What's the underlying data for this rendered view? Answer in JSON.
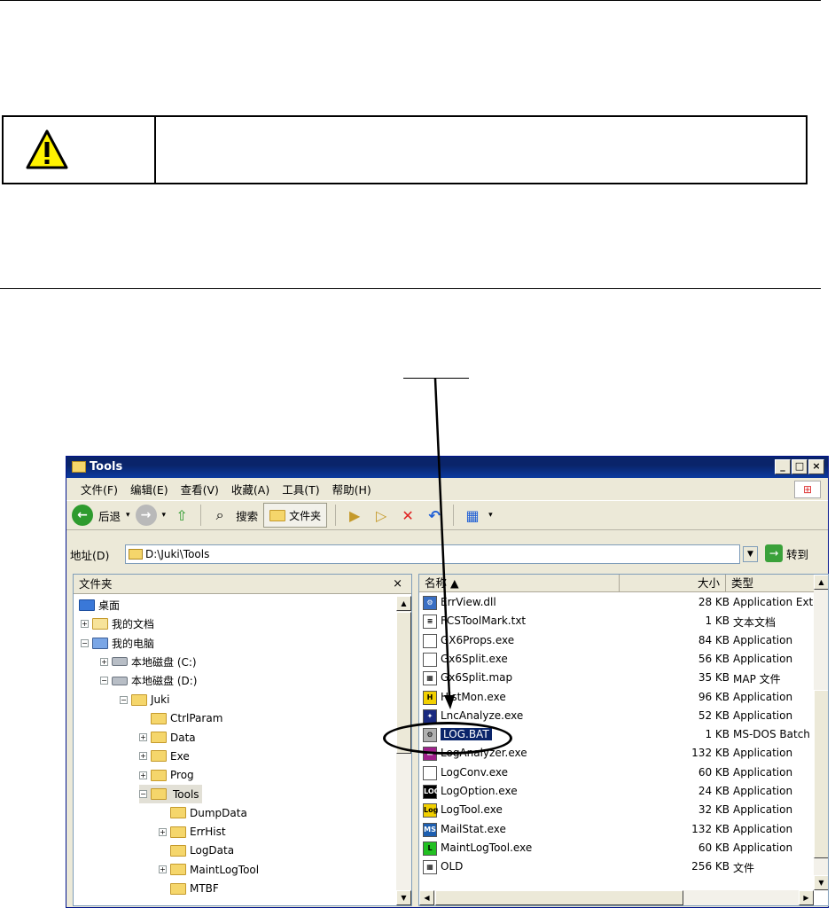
{
  "window": {
    "title": "Tools",
    "buttons": [
      "_",
      "□",
      "×"
    ],
    "menu": [
      "文件(F)",
      "编辑(E)",
      "查看(V)",
      "收藏(A)",
      "工具(T)",
      "帮助(H)"
    ],
    "toolbar": {
      "back": "后退",
      "search": "搜索",
      "folders": "文件夹"
    },
    "address": {
      "label": "地址(D)",
      "path": "D:\\Juki\\Tools",
      "go": "转到"
    }
  },
  "left_pane": {
    "title": "文件夹",
    "close": "×",
    "tree": [
      {
        "label": "桌面",
        "level": 0,
        "expander": "",
        "icon": "desktop-icon"
      },
      {
        "label": "我的文档",
        "level": 1,
        "expander": "+",
        "icon": "documents-icon"
      },
      {
        "label": "我的电脑",
        "level": 1,
        "expander": "−",
        "icon": "computer-icon"
      },
      {
        "label": "本地磁盘 (C:)",
        "level": 2,
        "expander": "+",
        "icon": "drive-icon"
      },
      {
        "label": "本地磁盘 (D:)",
        "level": 2,
        "expander": "−",
        "icon": "drive-icon"
      },
      {
        "label": "Juki",
        "level": 3,
        "expander": "−",
        "icon": "folder-icon"
      },
      {
        "label": "CtrlParam",
        "level": 4,
        "expander": "",
        "icon": "folder-icon"
      },
      {
        "label": "Data",
        "level": 4,
        "expander": "+",
        "icon": "folder-icon"
      },
      {
        "label": "Exe",
        "level": 4,
        "expander": "+",
        "icon": "folder-icon"
      },
      {
        "label": "Prog",
        "level": 4,
        "expander": "+",
        "icon": "folder-icon"
      },
      {
        "label": "Tools",
        "level": 4,
        "expander": "−",
        "icon": "folder-icon",
        "selected": true
      },
      {
        "label": "DumpData",
        "level": 5,
        "expander": "",
        "icon": "folder-icon"
      },
      {
        "label": "ErrHist",
        "level": 5,
        "expander": "+",
        "icon": "folder-icon"
      },
      {
        "label": "LogData",
        "level": 5,
        "expander": "",
        "icon": "folder-icon"
      },
      {
        "label": "MaintLogTool",
        "level": 5,
        "expander": "+",
        "icon": "folder-icon"
      },
      {
        "label": "MTBF",
        "level": 5,
        "expander": "",
        "icon": "folder-icon"
      }
    ]
  },
  "right_pane": {
    "columns": [
      "名称 ▲",
      "大小",
      "类型"
    ],
    "files": [
      {
        "name": "ErrView.dll",
        "size": "28 KB",
        "type": "Application Exte",
        "icon": "dll-icon",
        "badge": "⚙",
        "color": "#3a6fc4"
      },
      {
        "name": "FCSToolMark.txt",
        "size": "1 KB",
        "type": "文本文档",
        "icon": "text-file-icon",
        "badge": "≡",
        "color": "#ffffff"
      },
      {
        "name": "GX6Props.exe",
        "size": "84 KB",
        "type": "Application",
        "icon": "window-app-icon",
        "badge": "",
        "color": "#ffffff"
      },
      {
        "name": "Gx6Split.exe",
        "size": "56 KB",
        "type": "Application",
        "icon": "window-app-icon",
        "badge": "",
        "color": "#ffffff"
      },
      {
        "name": "Gx6Split.map",
        "size": "35 KB",
        "type": "MAP 文件",
        "icon": "map-file-icon",
        "badge": "▦",
        "color": "#ffffff"
      },
      {
        "name": "HistMon.exe",
        "size": "96 KB",
        "type": "Application",
        "icon": "histmon-icon",
        "badge": "H",
        "color": "#f2d000"
      },
      {
        "name": "LncAnalyze.exe",
        "size": "52 KB",
        "type": "Application",
        "icon": "analyze-icon",
        "badge": "✦",
        "color": "#1a2a80"
      },
      {
        "name": "LOG.BAT",
        "size": "1 KB",
        "type": "MS-DOS Batch",
        "icon": "batch-file-icon",
        "badge": "⚙",
        "color": "#b0b0b0",
        "selected": true
      },
      {
        "name": "LogAnalyzer.exe",
        "size": "132 KB",
        "type": "Application",
        "icon": "loganalyzer-icon",
        "badge": "▬",
        "color": "#a0208c"
      },
      {
        "name": "LogConv.exe",
        "size": "60 KB",
        "type": "Application",
        "icon": "window-app-icon",
        "badge": "",
        "color": "#ffffff"
      },
      {
        "name": "LogOption.exe",
        "size": "24 KB",
        "type": "Application",
        "icon": "logoption-icon",
        "badge": "LOG",
        "color": "#000000"
      },
      {
        "name": "LogTool.exe",
        "size": "32 KB",
        "type": "Application",
        "icon": "logtool-icon",
        "badge": "Log",
        "color": "#f2d000"
      },
      {
        "name": "MailStat.exe",
        "size": "132 KB",
        "type": "Application",
        "icon": "mailstat-icon",
        "badge": "MS",
        "color": "#1e5fb0"
      },
      {
        "name": "MaintLogTool.exe",
        "size": "60 KB",
        "type": "Application",
        "icon": "maintlog-icon",
        "badge": "L",
        "color": "#22c022"
      },
      {
        "name": "OLD",
        "size": "256 KB",
        "type": "文件",
        "icon": "generic-file-icon",
        "badge": "▦",
        "color": "#ffffff"
      }
    ]
  }
}
